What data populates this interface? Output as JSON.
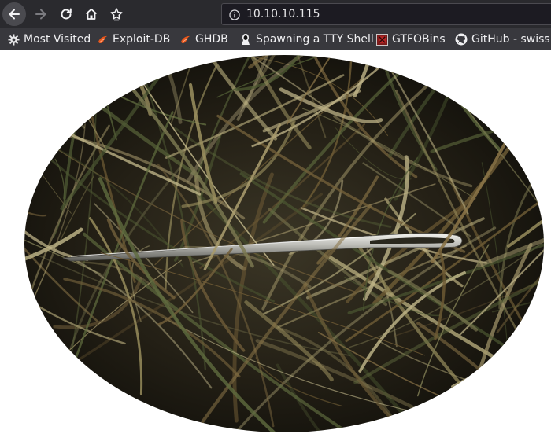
{
  "browser": {
    "url": "10.10.10.115",
    "bookmarks": [
      {
        "label": "Most Visited",
        "icon": "gear-icon"
      },
      {
        "label": "Exploit-DB",
        "icon": "exploitdb-icon"
      },
      {
        "label": "GHDB",
        "icon": "ghdb-icon"
      },
      {
        "label": "Spawning a TTY Shell",
        "icon": "hacker-icon"
      },
      {
        "label": "GTFOBins",
        "icon": "gtfobins-icon"
      },
      {
        "label": "GitHub - swiss",
        "icon": "github-icon"
      }
    ]
  },
  "page": {
    "image": {
      "subject": "needle-in-haystack"
    }
  },
  "colors": {
    "toolbar": "#2a2a2e",
    "bookmarks_bar": "#38383d",
    "urlbar": "#1c1b22",
    "page_bg": "#ffffff",
    "exploit_orange": "#e8561b"
  }
}
